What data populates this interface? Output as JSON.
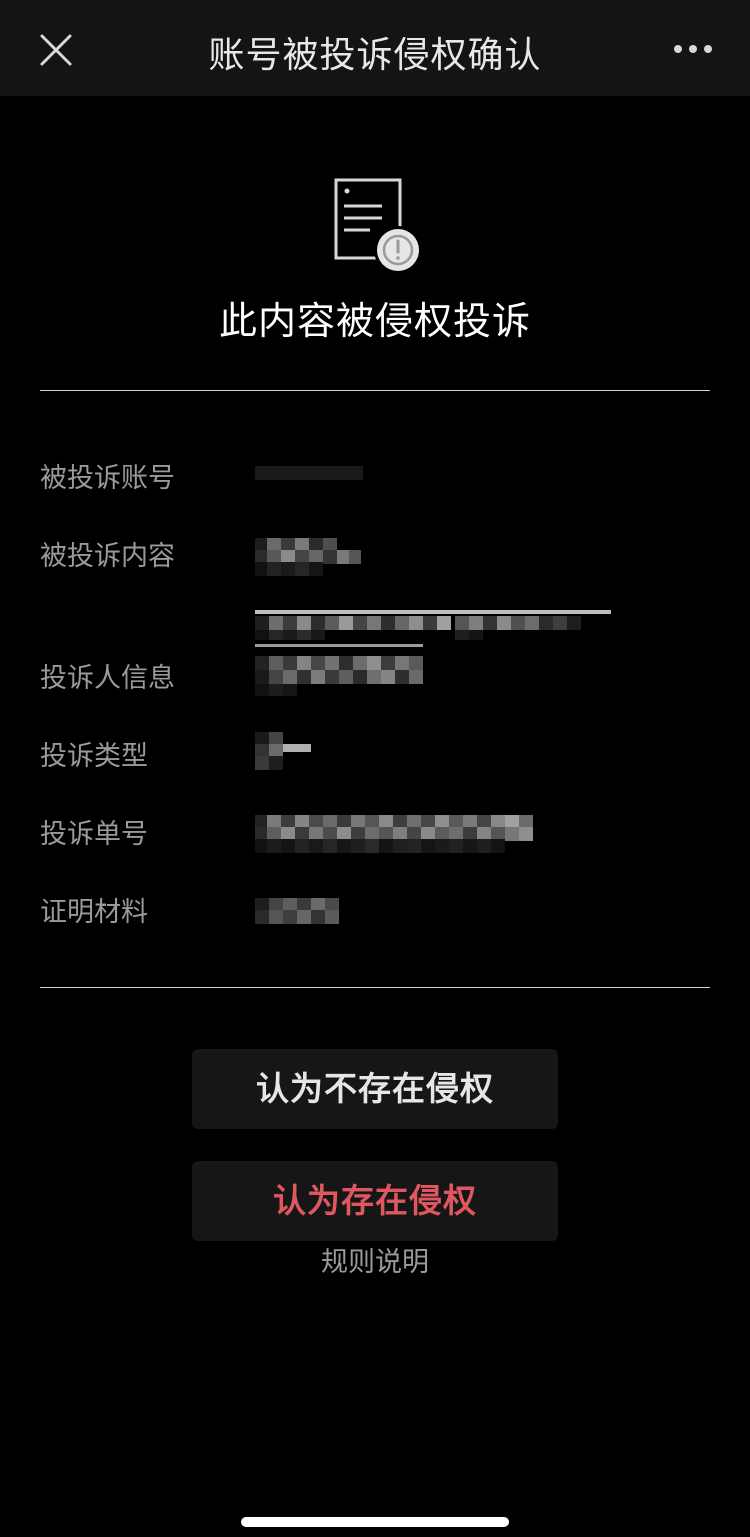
{
  "nav": {
    "title": "账号被投诉侵权确认",
    "close_icon": "close-icon",
    "more_icon": "more-icon"
  },
  "header": {
    "icon": "document-warning-icon",
    "title": "此内容被侵权投诉"
  },
  "details": [
    {
      "label": "被投诉账号",
      "value_redacted": true
    },
    {
      "label": "被投诉内容",
      "value_redacted": true
    },
    {
      "label": "投诉人信息",
      "value_redacted": true
    },
    {
      "label": "投诉类型",
      "value_redacted": true
    },
    {
      "label": "投诉单号",
      "value_redacted": true
    },
    {
      "label": "证明材料",
      "value_redacted": true
    }
  ],
  "actions": {
    "no_infringement_label": "认为不存在侵权",
    "infringement_label": "认为存在侵权",
    "rules_label": "规则说明"
  },
  "colors": {
    "background": "#000000",
    "nav_background": "#141414",
    "button_background": "#161616",
    "danger": "#e0585f",
    "label_gray": "#9a9a9a"
  }
}
